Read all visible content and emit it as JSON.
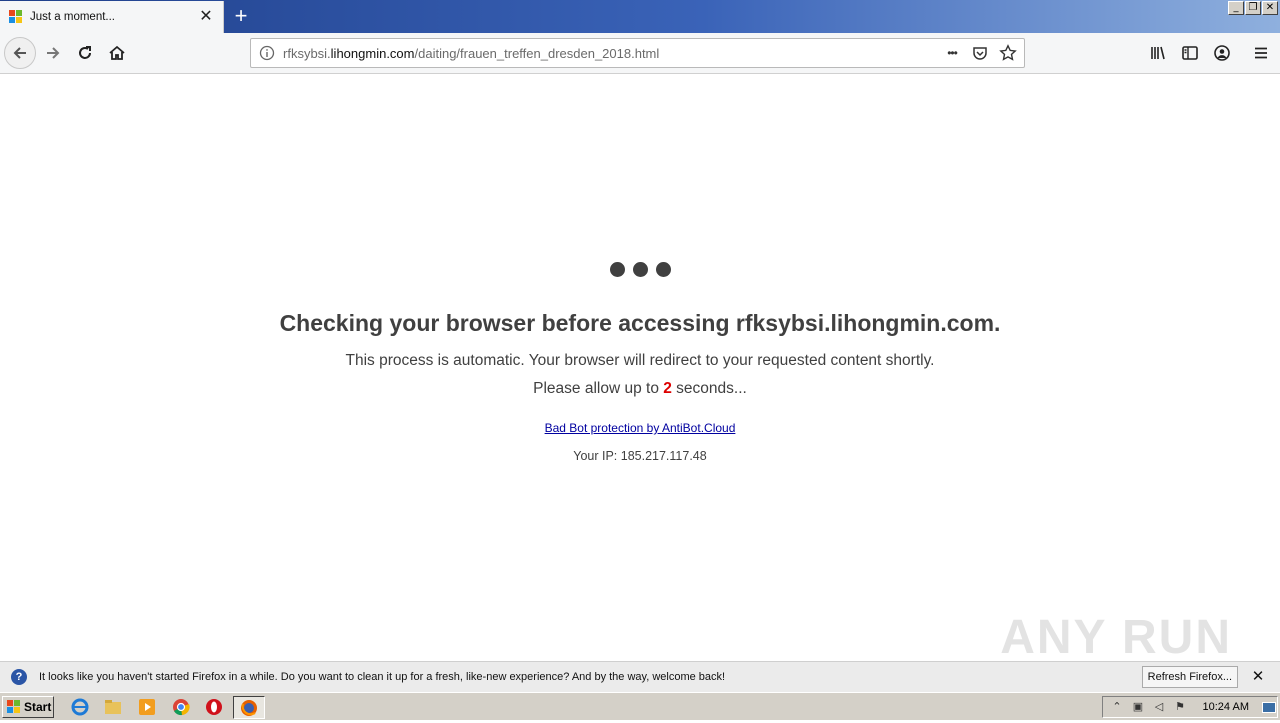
{
  "browser": {
    "tab": {
      "title": "Just a moment...",
      "close_glyph": "✕"
    },
    "new_tab_glyph": "+",
    "window_controls": {
      "minimize": "_",
      "restore": "❐",
      "close": "✕"
    },
    "url": {
      "prefix": "rfksybsi.",
      "host": "lihongmin.com",
      "path": "/daiting/frauen_treffen_dresden_2018.html"
    },
    "url_more_glyph": "•••"
  },
  "page": {
    "heading": "Checking your browser before accessing rfksybsi.lihongmin.com.",
    "line1": "This process is automatic. Your browser will redirect to your requested content shortly.",
    "line2_before": "Please allow up to ",
    "seconds": "2",
    "line2_after": " seconds...",
    "bot_link": "Bad Bot protection by AntiBot.Cloud",
    "ip_label": "Your IP: 185.217.117.48"
  },
  "watermark": "ANY RUN",
  "notification": {
    "message": "It looks like you haven't started Firefox in a while. Do you want to clean it up for a fresh, like-new experience? And by the way, welcome back!",
    "button": "Refresh Firefox...",
    "close_glyph": "✕",
    "icon_glyph": "?"
  },
  "taskbar": {
    "start_label": "Start",
    "time": "10:24 AM",
    "icons": [
      "internet-explorer-icon",
      "file-explorer-icon",
      "media-player-icon",
      "chrome-icon",
      "opera-icon",
      "firefox-icon"
    ]
  },
  "colors": {
    "accent_red": "#dd0000",
    "text": "#404040",
    "link": "#0000a0"
  }
}
